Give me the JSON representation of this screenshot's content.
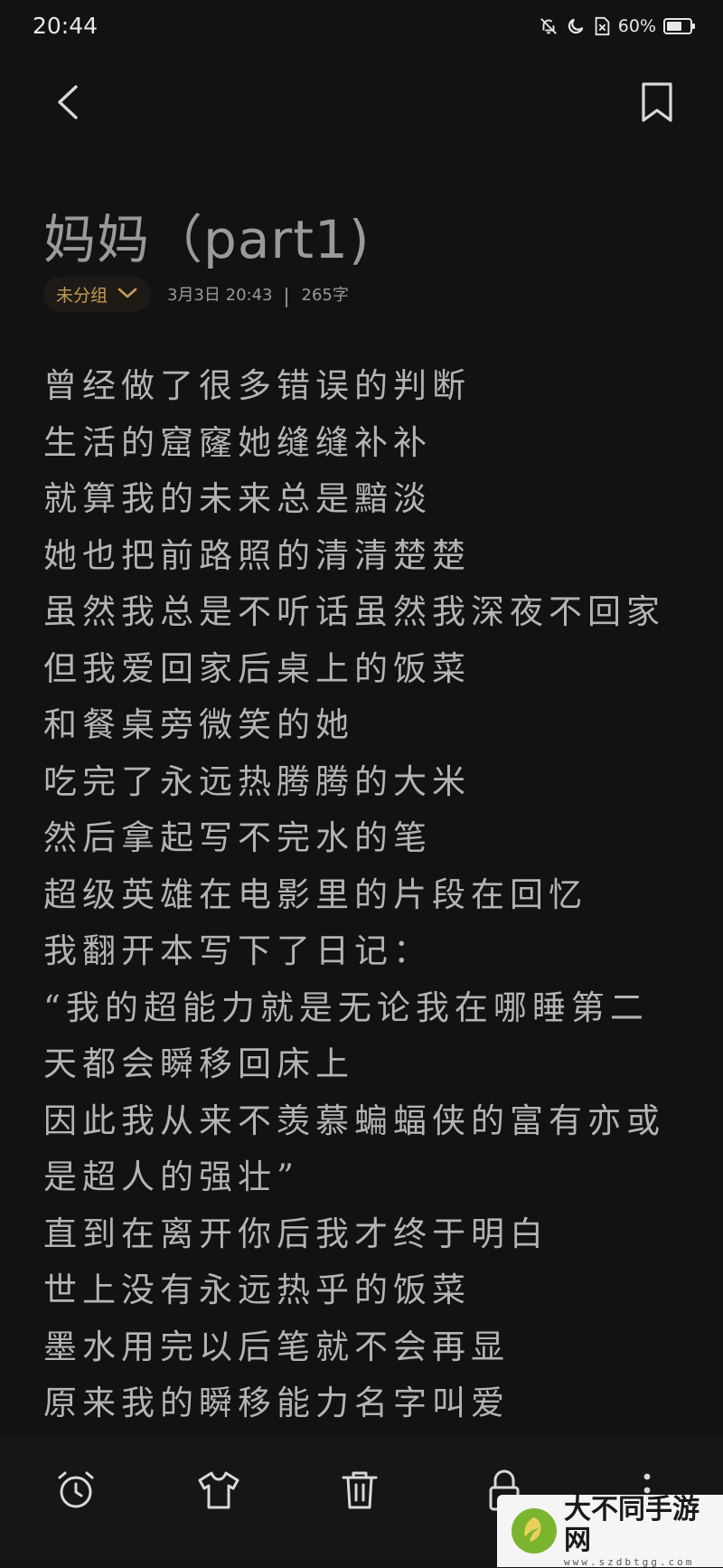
{
  "status_bar": {
    "time": "20:44",
    "battery_percent": "60%"
  },
  "note": {
    "title": "妈妈（part1)",
    "group_label": "未分组",
    "date": "3月3日 20:43",
    "word_count": "265字",
    "lines": [
      "曾经做了很多错误的判断",
      "生活的窟窿她缝缝补补",
      "就算我的未来总是黯淡",
      "她也把前路照的清清楚楚",
      "虽然我总是不听话虽然我深夜不回家",
      "但我爱回家后桌上的饭菜",
      "和餐桌旁微笑的她",
      "吃完了永远热腾腾的大米",
      "然后拿起写不完水的笔",
      "超级英雄在电影里的片段在回忆",
      "我翻开本写下了日记：",
      "“我的超能力就是无论我在哪睡第二",
      "天都会瞬移回床上",
      "因此我从来不羡慕蝙蝠侠的富有亦或",
      "是超人的强壮”",
      "直到在离开你后我才终于明白",
      "世上没有永远热乎的饭菜",
      "墨水用完以后笔就不会再显",
      "原来我的瞬移能力名字叫爱"
    ]
  },
  "watermark": {
    "name": "大不同手游网",
    "url": "www.szdbtgg.com"
  },
  "colors": {
    "background": "#121212",
    "accent": "#c79a52",
    "text": "#b4b4b4"
  }
}
